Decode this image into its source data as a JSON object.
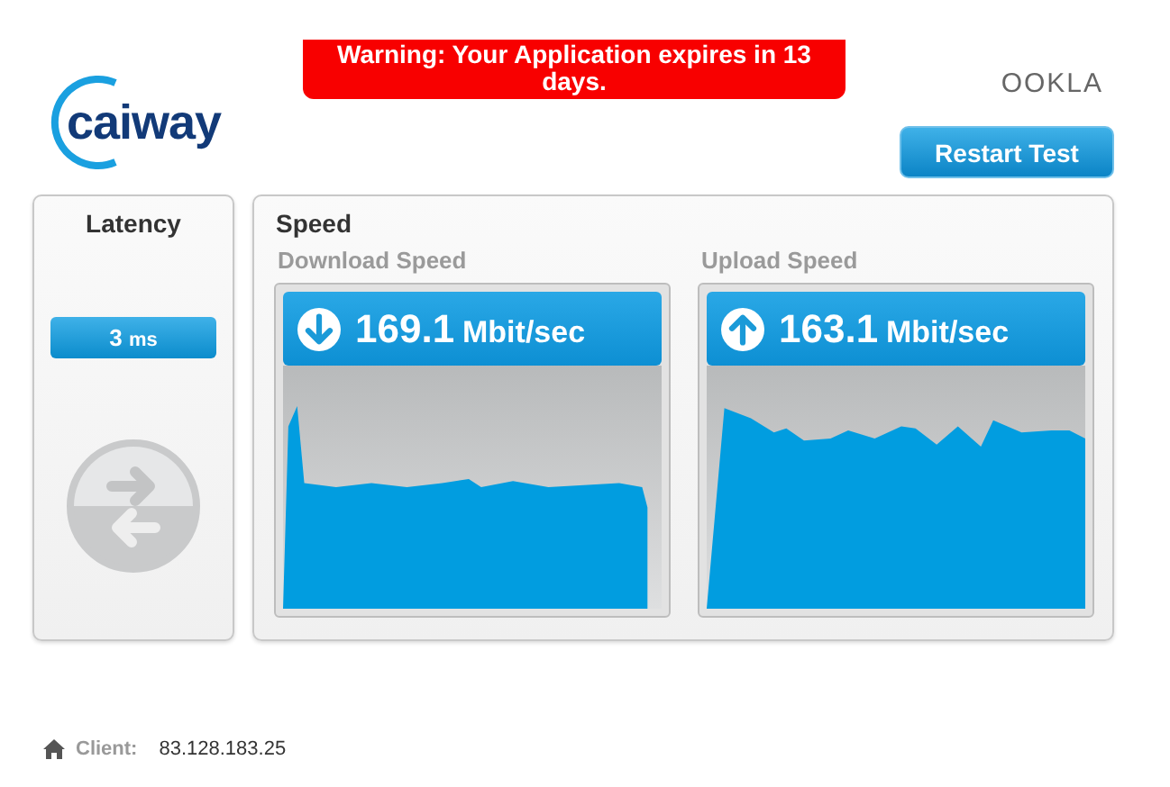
{
  "logo": {
    "text": "caiway"
  },
  "warning": "Warning: Your Application expires in 13 days.",
  "provider_logo": {
    "text": "OOKLA"
  },
  "restart_button": "Restart Test",
  "latency": {
    "title": "Latency",
    "value": "3",
    "unit": "ms"
  },
  "speed": {
    "title": "Speed",
    "tests": [
      {
        "kind": "download",
        "label": "Download Speed",
        "value": "169.1",
        "unit": "Mbit/sec"
      },
      {
        "kind": "upload",
        "label": "Upload Speed",
        "value": "163.1",
        "unit": "Mbit/sec"
      }
    ]
  },
  "client": {
    "label": "Client:",
    "ip": "83.128.183.25"
  }
}
